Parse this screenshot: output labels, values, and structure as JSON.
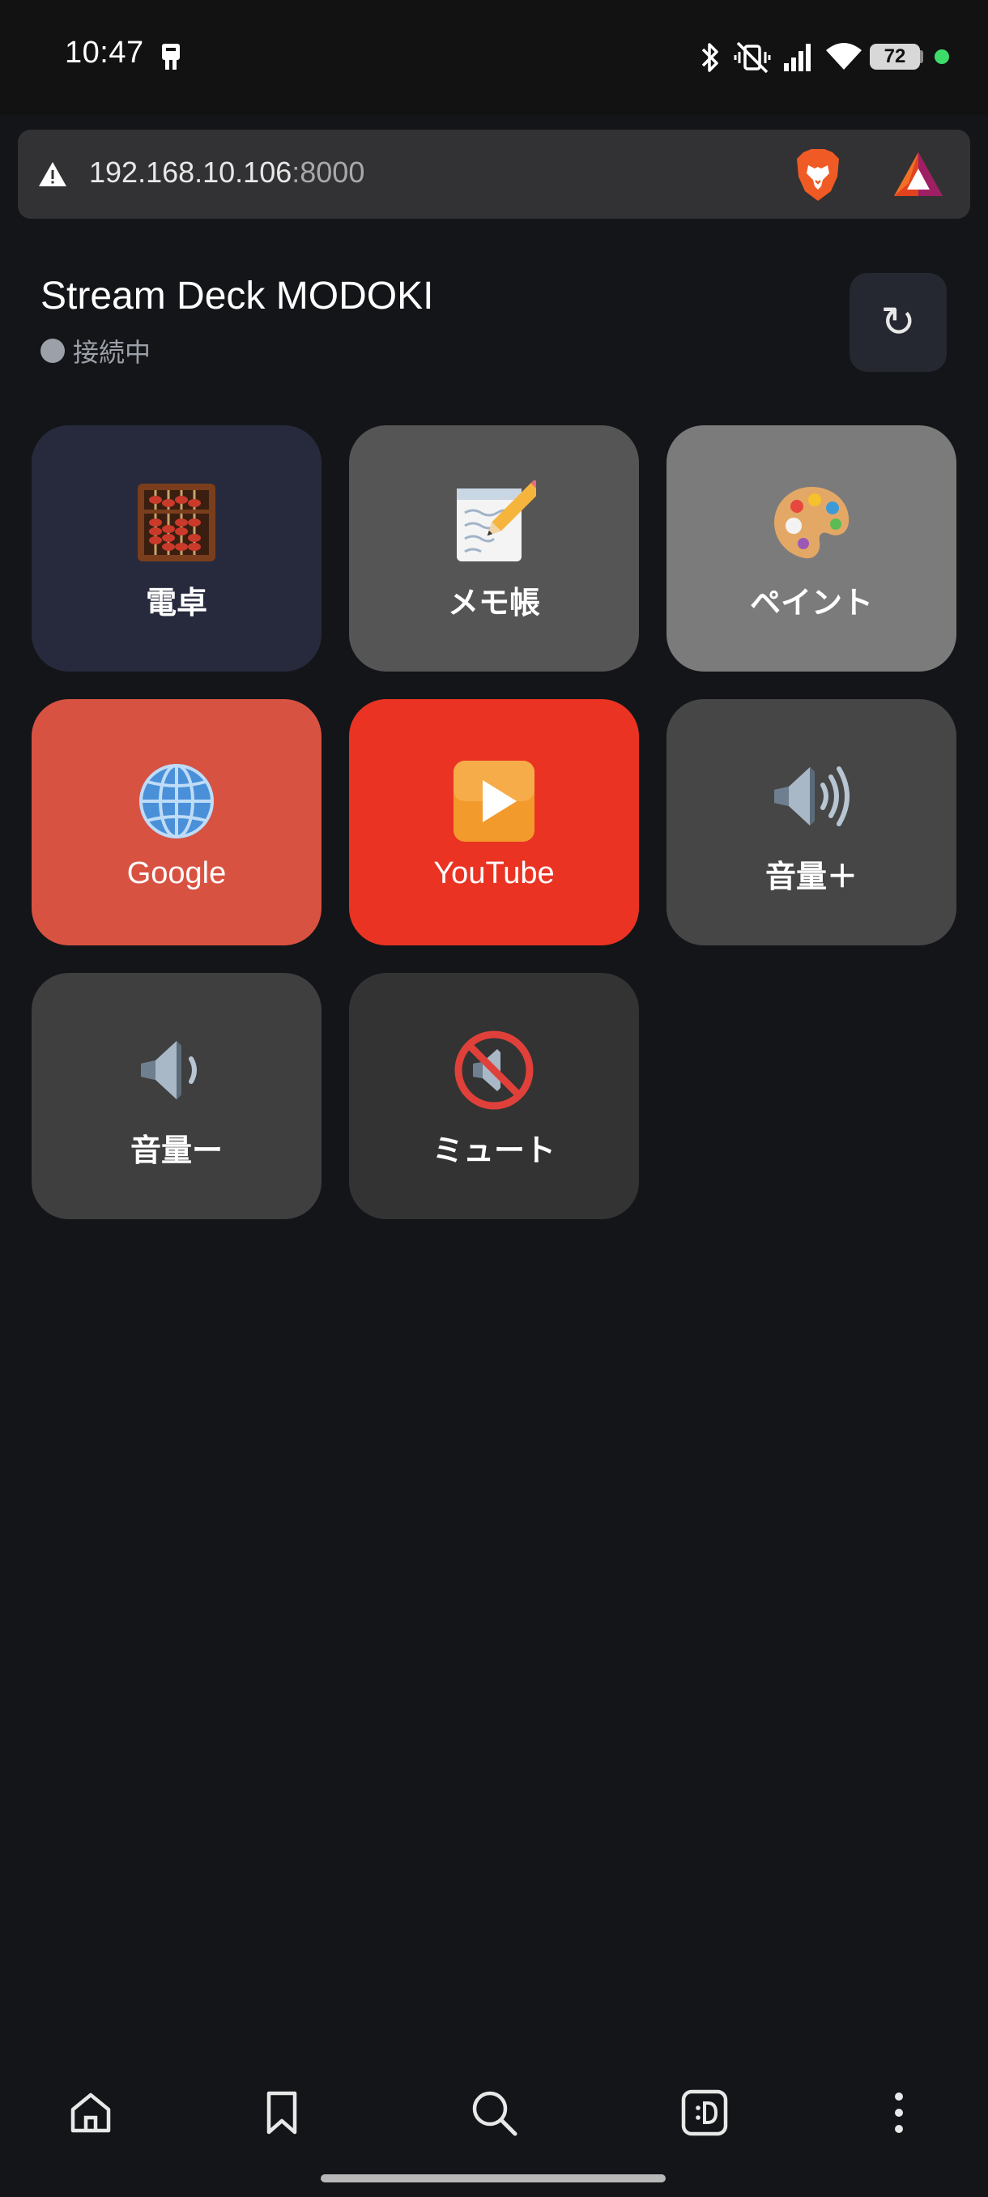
{
  "status_bar": {
    "time": "10:47",
    "battery": "72"
  },
  "browser": {
    "url_host": "192.168.10.106",
    "url_port": ":8000"
  },
  "app": {
    "title": "Stream Deck MODOKI",
    "connection_status": "接続中",
    "refresh_symbol": "↻"
  },
  "buttons": [
    {
      "label": "電卓",
      "icon": "abacus-icon",
      "color": "#272a3d"
    },
    {
      "label": "メモ帳",
      "icon": "memo-icon",
      "color": "#555555"
    },
    {
      "label": "ペイント",
      "icon": "palette-icon",
      "color": "#7b7b7b"
    },
    {
      "label": "Google",
      "icon": "globe-icon",
      "color": "#d85242"
    },
    {
      "label": "YouTube",
      "icon": "play-button-icon",
      "color": "#ea3323"
    },
    {
      "label": "音量＋",
      "icon": "speaker-high-volume-icon",
      "color": "#464646"
    },
    {
      "label": "音量ー",
      "icon": "speaker-low-volume-icon",
      "color": "#3f3f3f"
    },
    {
      "label": "ミュート",
      "icon": "muted-speaker-icon",
      "color": "#333333"
    }
  ],
  "bottom_nav": [
    "home-icon",
    "bookmark-icon",
    "search-icon",
    "wallet-icon",
    "more-icon"
  ]
}
